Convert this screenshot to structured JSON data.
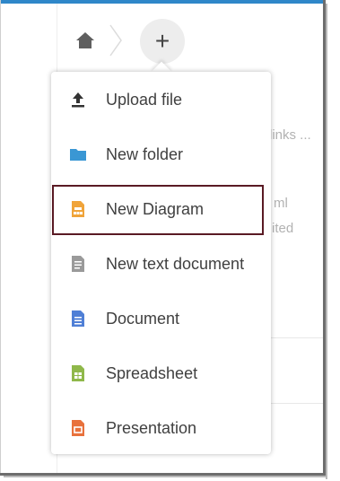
{
  "breadcrumb": {
    "home_icon": "home-icon",
    "add_symbol": "+"
  },
  "background": {
    "fragment_links": "links ...",
    "fragment_ml": "ml",
    "fragment_ited": "ited"
  },
  "menu": {
    "items": [
      {
        "label": "Upload file",
        "icon": "upload-icon",
        "color": "#333333"
      },
      {
        "label": "New folder",
        "icon": "folder-icon",
        "color": "#3a97d4"
      },
      {
        "label": "New Diagram",
        "icon": "diagram-icon",
        "color": "#f0a43a",
        "highlighted": true
      },
      {
        "label": "New text document",
        "icon": "text-document-icon",
        "color": "#8c8c8c"
      },
      {
        "label": "Document",
        "icon": "document-icon",
        "color": "#4f7fd6"
      },
      {
        "label": "Spreadsheet",
        "icon": "spreadsheet-icon",
        "color": "#8fb84a"
      },
      {
        "label": "Presentation",
        "icon": "presentation-icon",
        "color": "#e8713c"
      }
    ]
  },
  "colors": {
    "accent": "#2f87c9",
    "highlight_border": "#5a1a24"
  }
}
